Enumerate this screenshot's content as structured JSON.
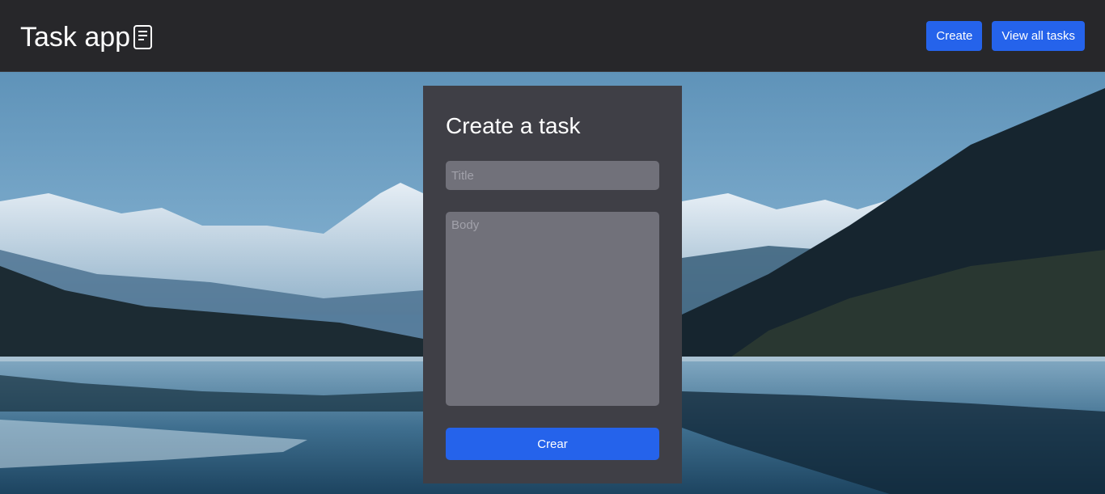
{
  "navbar": {
    "brand_title": "Task app",
    "brand_icon": "document-icon",
    "buttons": {
      "create_label": "Create",
      "view_all_label": "View all tasks"
    }
  },
  "form": {
    "title": "Create a task",
    "title_placeholder": "Title",
    "body_placeholder": "Body",
    "submit_label": "Crear"
  },
  "colors": {
    "navbar_bg": "#27272a",
    "accent": "#2563eb",
    "card_bg": "#3f3f46",
    "input_bg": "#71717a"
  },
  "background": {
    "description_icon": "mountain-lake-landscape"
  }
}
